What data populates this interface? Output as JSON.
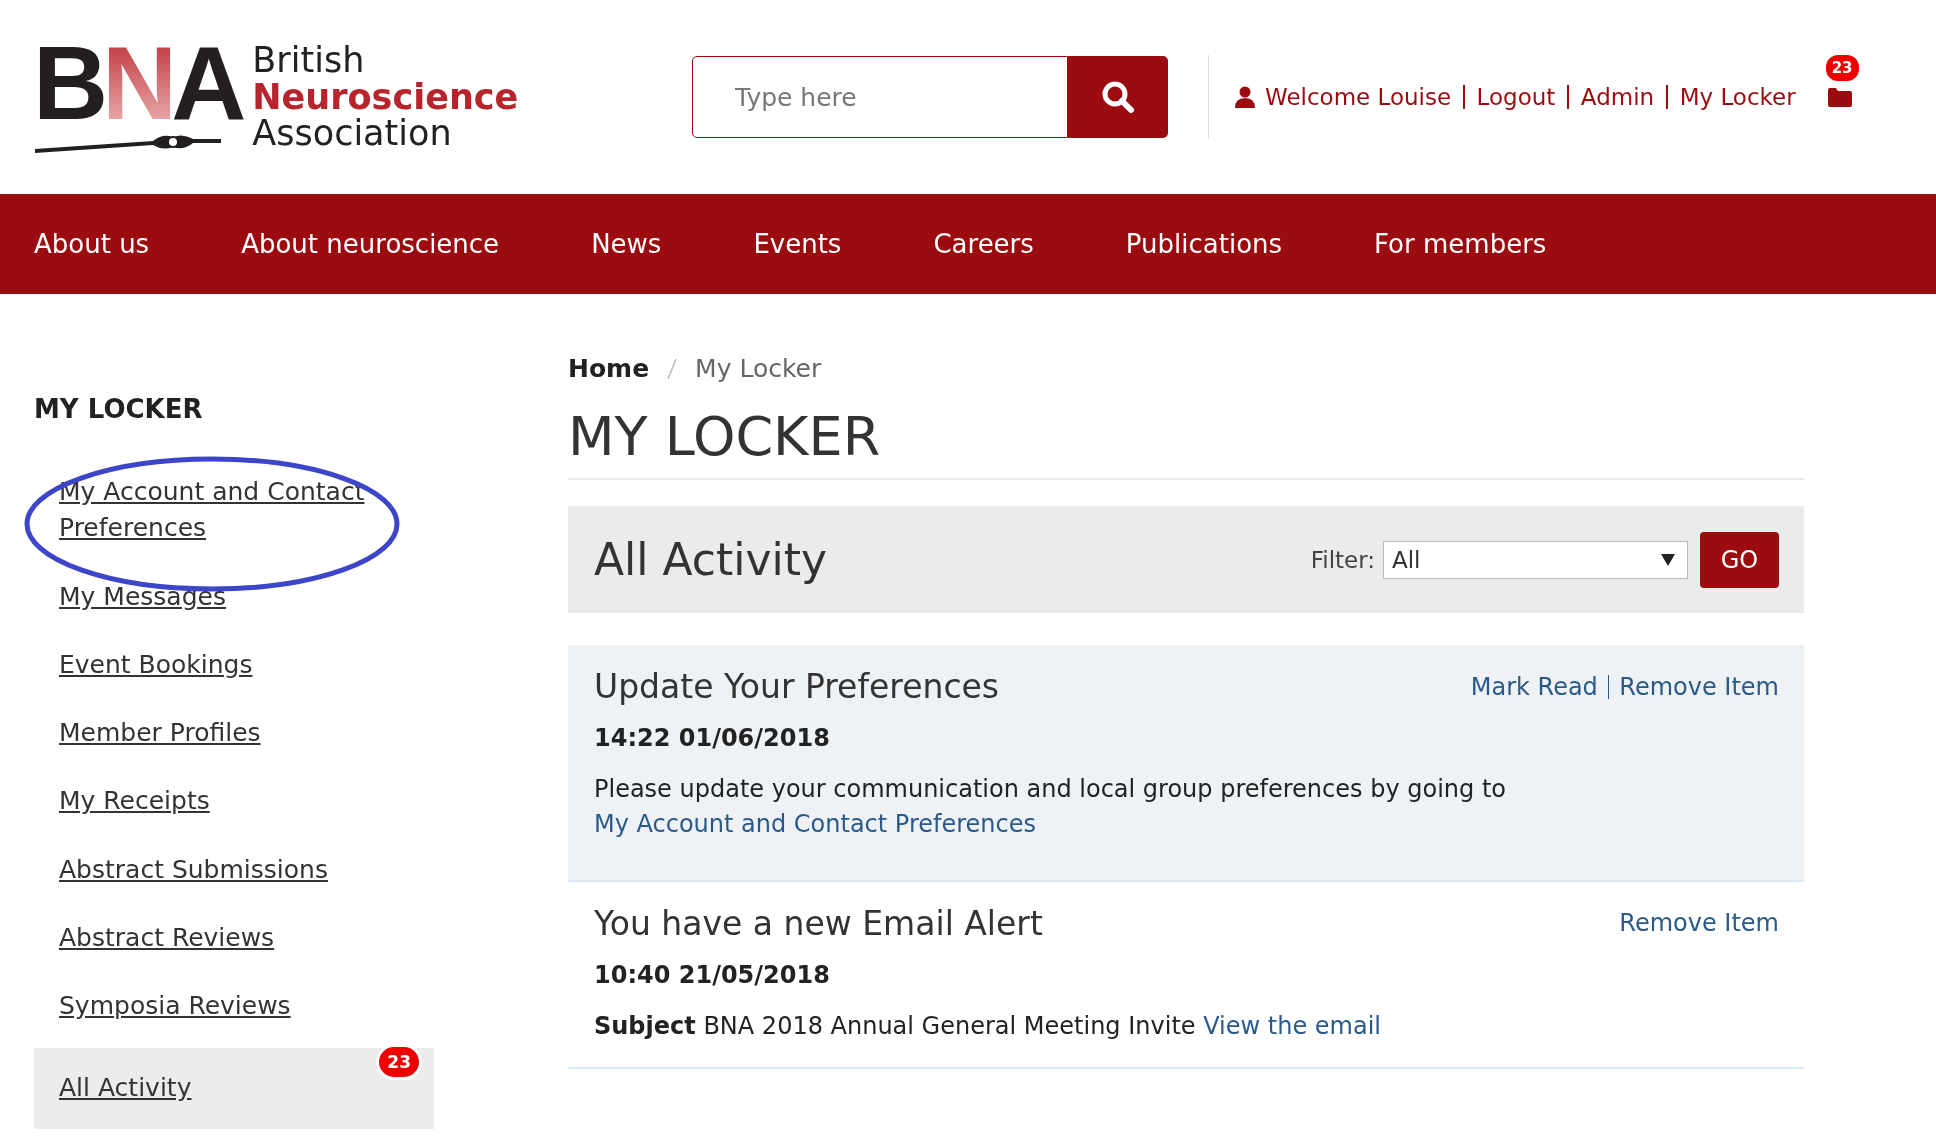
{
  "logo": {
    "letters": "BNA",
    "lines": [
      "British",
      "Neuroscience",
      "Association"
    ]
  },
  "search": {
    "placeholder": "Type here"
  },
  "user_links": [
    "Welcome Louise",
    "Logout",
    "Admin",
    "My Locker"
  ],
  "locker_badge": "23",
  "nav": [
    "About us",
    "About neuroscience",
    "News",
    "Events",
    "Careers",
    "Publications",
    "For members"
  ],
  "sidebar": {
    "title": "MY LOCKER",
    "items": [
      {
        "label": "My Account and Contact Preferences",
        "selected": false,
        "highlighted": true
      },
      {
        "label": "My Messages",
        "selected": false,
        "highlighted": false
      },
      {
        "label": "Event Bookings",
        "selected": false,
        "highlighted": false
      },
      {
        "label": "Member Profiles",
        "selected": false,
        "highlighted": false
      },
      {
        "label": "My Receipts",
        "selected": false,
        "highlighted": false
      },
      {
        "label": "Abstract Submissions",
        "selected": false,
        "highlighted": false
      },
      {
        "label": "Abstract Reviews",
        "selected": false,
        "highlighted": false
      },
      {
        "label": "Symposia Reviews",
        "selected": false,
        "highlighted": false
      },
      {
        "label": "All Activity",
        "selected": true,
        "highlighted": false,
        "badge": "23"
      }
    ]
  },
  "breadcrumb": [
    "Home",
    "My Locker"
  ],
  "page_title": "MY LOCKER",
  "panel": {
    "title": "All Activity",
    "filter_label": "Filter:",
    "filter_value": "All",
    "button": "GO"
  },
  "activity": [
    {
      "title": "Update Your Preferences",
      "unread": true,
      "actions": [
        "Mark Read",
        "Remove Item"
      ],
      "date": "14:22 01/06/2018",
      "text": "Please update your communication and local group preferences by going to",
      "link": "My Account and Contact Preferences"
    },
    {
      "title": "You have a new Email Alert",
      "unread": false,
      "actions": [
        "Remove Item"
      ],
      "date": "10:40 21/05/2018",
      "text": "**Subject** BNA 2018 Annual General Meeting Invite",
      "link": "View the email"
    }
  ]
}
